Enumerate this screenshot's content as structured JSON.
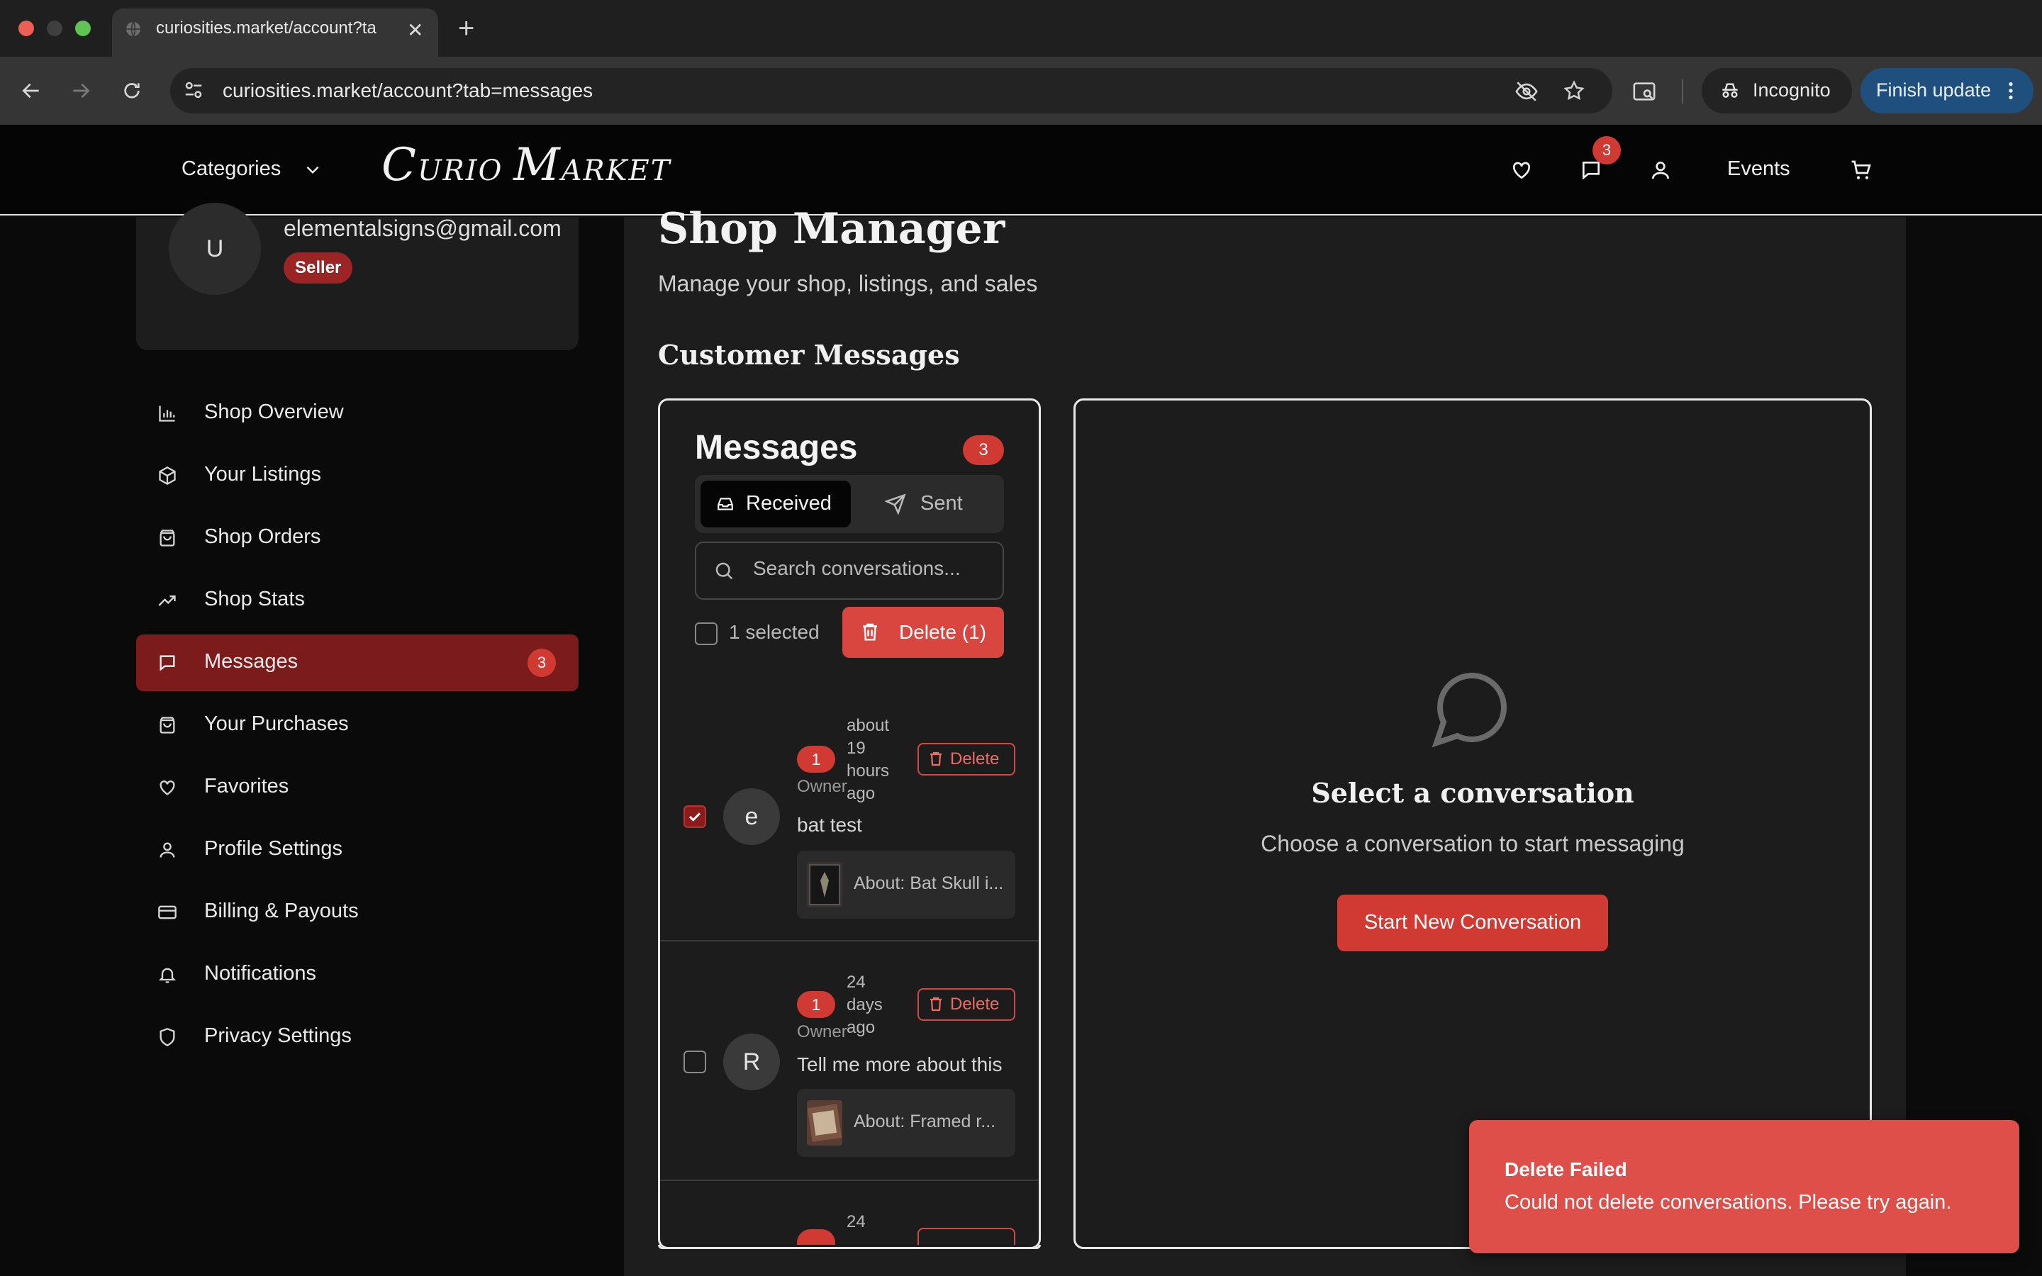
{
  "browser": {
    "tab_title": "curiosities.market/account?ta",
    "url": "curiosities.market/account?tab=messages",
    "incognito_label": "Incognito",
    "finish_update_label": "Finish update"
  },
  "header": {
    "categories_label": "Categories",
    "logo": {
      "c": "C",
      "urio": "URIO",
      "m": "M",
      "arket": "ARKET"
    },
    "messages_badge": "3",
    "events_label": "Events"
  },
  "profile": {
    "avatar_initial": "U",
    "email": "elementalsigns@gmail.com",
    "role_badge": "Seller"
  },
  "sidebar": {
    "items": [
      {
        "label": "Shop Overview",
        "icon": "bar-chart-icon"
      },
      {
        "label": "Your Listings",
        "icon": "package-icon"
      },
      {
        "label": "Shop Orders",
        "icon": "shopping-bag-icon"
      },
      {
        "label": "Shop Stats",
        "icon": "trending-up-icon"
      },
      {
        "label": "Messages",
        "icon": "message-square-icon",
        "badge": "3",
        "active": true
      },
      {
        "label": "Your Purchases",
        "icon": "shopping-bag-icon"
      },
      {
        "label": "Favorites",
        "icon": "heart-icon"
      },
      {
        "label": "Profile Settings",
        "icon": "user-icon"
      },
      {
        "label": "Billing & Payouts",
        "icon": "credit-card-icon"
      },
      {
        "label": "Notifications",
        "icon": "bell-icon"
      },
      {
        "label": "Privacy Settings",
        "icon": "shield-icon"
      }
    ]
  },
  "main": {
    "title": "Shop Manager",
    "subtitle": "Manage your shop, listings, and sales",
    "section_title": "Customer Messages"
  },
  "messages": {
    "heading": "Messages",
    "count": "3",
    "tabs": {
      "received": "Received",
      "sent": "Sent"
    },
    "search_placeholder": "Search conversations...",
    "selected_label": "1 selected",
    "bulk_delete_label": "Delete (1)",
    "conversations": [
      {
        "initial": "e",
        "unread": "1",
        "owner": "Owner",
        "time": "about 19 hours ago",
        "delete": "Delete",
        "preview": "bat test",
        "about": "About: Bat Skull i...",
        "selected": true
      },
      {
        "initial": "R",
        "unread": "1",
        "owner": "Owner",
        "time": "24 days ago",
        "delete": "Delete",
        "preview": "Tell me more about this",
        "about": "About: Framed r...",
        "selected": false
      },
      {
        "time": "24"
      }
    ]
  },
  "conversation_pane": {
    "empty_title": "Select a conversation",
    "empty_subtitle": "Choose a conversation to start messaging",
    "start_button": "Start New Conversation"
  },
  "toast": {
    "title": "Delete Failed",
    "body": "Could not delete conversations. Please try again."
  },
  "colors": {
    "accent_red": "#d13a33",
    "active_sidebar": "#7b1b1b",
    "toast_bg": "#df4f4a"
  }
}
